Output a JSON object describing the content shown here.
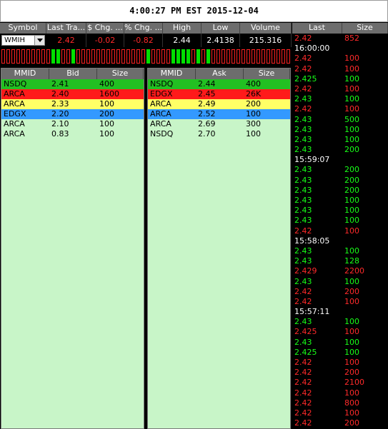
{
  "title": "4:00:27 PM EST 2015-12-04",
  "quote": {
    "headers": [
      "Symbol",
      "Last Tra...",
      "$ Chg. ...",
      "% Chg. ...",
      "High",
      "Low",
      "Volume"
    ],
    "symbol": "WMIH",
    "last": "2.42",
    "chg": "-0.02",
    "pct_chg": "-0.82",
    "high": "2.44",
    "low": "2.4138",
    "volume": "215.316"
  },
  "tick_pattern": [
    0,
    0,
    0,
    0,
    0,
    0,
    0,
    0,
    0,
    0,
    1,
    1,
    0,
    0,
    1,
    0,
    0,
    0,
    0,
    0,
    0,
    0,
    0,
    0,
    0,
    0,
    0,
    0,
    0,
    1,
    0,
    0,
    0,
    0,
    1,
    1,
    1,
    1,
    0,
    1,
    0,
    1,
    0,
    0,
    0,
    0,
    0,
    0,
    0,
    0,
    0,
    0,
    0,
    0,
    0,
    0,
    0,
    0
  ],
  "bid_panel": {
    "headers": [
      "MMID",
      "Bid",
      "Size"
    ],
    "rows": [
      {
        "mmid": "NSDQ",
        "price": "2.41",
        "size": "400",
        "color": "#22c022"
      },
      {
        "mmid": "ARCA",
        "price": "2.40",
        "size": "1600",
        "color": "#ff1a1a"
      },
      {
        "mmid": "ARCA",
        "price": "2.33",
        "size": "100",
        "color": "#ffff66"
      },
      {
        "mmid": "EDGX",
        "price": "2.20",
        "size": "200",
        "color": "#3399ff"
      },
      {
        "mmid": "ARCA",
        "price": "2.10",
        "size": "100",
        "color": "#c8f5c8"
      },
      {
        "mmid": "ARCA",
        "price": "0.83",
        "size": "100",
        "color": "#c8f5c8"
      }
    ]
  },
  "ask_panel": {
    "headers": [
      "MMID",
      "Ask",
      "Size"
    ],
    "rows": [
      {
        "mmid": "NSDQ",
        "price": "2.44",
        "size": "400",
        "color": "#22c022"
      },
      {
        "mmid": "EDGX",
        "price": "2.45",
        "size": "26K",
        "color": "#ff1a1a"
      },
      {
        "mmid": "ARCA",
        "price": "2.49",
        "size": "200",
        "color": "#ffff66"
      },
      {
        "mmid": "ARCA",
        "price": "2.52",
        "size": "100",
        "color": "#3399ff"
      },
      {
        "mmid": "ARCA",
        "price": "2.69",
        "size": "300",
        "color": "#c8f5c8"
      },
      {
        "mmid": "NSDQ",
        "price": "2.70",
        "size": "100",
        "color": "#c8f5c8"
      }
    ]
  },
  "time_sales": {
    "headers": [
      "Last",
      "Size"
    ],
    "rows": [
      {
        "p": "2.42",
        "s": "852",
        "c": "red"
      },
      {
        "time": "16:00:00"
      },
      {
        "p": "2.42",
        "s": "100",
        "c": "red"
      },
      {
        "p": "2.42",
        "s": "100",
        "c": "red"
      },
      {
        "p": "2.425",
        "s": "100",
        "c": "green"
      },
      {
        "p": "2.42",
        "s": "100",
        "c": "red"
      },
      {
        "p": "2.43",
        "s": "100",
        "c": "green"
      },
      {
        "p": "2.42",
        "s": "100",
        "c": "red"
      },
      {
        "p": "2.43",
        "s": "500",
        "c": "green"
      },
      {
        "p": "2.43",
        "s": "100",
        "c": "green"
      },
      {
        "p": "2.43",
        "s": "100",
        "c": "green"
      },
      {
        "p": "2.43",
        "s": "200",
        "c": "green"
      },
      {
        "time": "15:59:07"
      },
      {
        "p": "2.43",
        "s": "200",
        "c": "green"
      },
      {
        "p": "2.43",
        "s": "200",
        "c": "green"
      },
      {
        "p": "2.43",
        "s": "200",
        "c": "green"
      },
      {
        "p": "2.43",
        "s": "100",
        "c": "green"
      },
      {
        "p": "2.43",
        "s": "100",
        "c": "green"
      },
      {
        "p": "2.43",
        "s": "100",
        "c": "green"
      },
      {
        "p": "2.42",
        "s": "100",
        "c": "red"
      },
      {
        "time": "15:58:05"
      },
      {
        "p": "2.43",
        "s": "100",
        "c": "green"
      },
      {
        "p": "2.43",
        "s": "128",
        "c": "green"
      },
      {
        "p": "2.429",
        "s": "2200",
        "c": "red"
      },
      {
        "p": "2.43",
        "s": "100",
        "c": "green"
      },
      {
        "p": "2.42",
        "s": "200",
        "c": "red"
      },
      {
        "p": "2.42",
        "s": "100",
        "c": "red"
      },
      {
        "time": "15:57:11"
      },
      {
        "p": "2.43",
        "s": "100",
        "c": "green"
      },
      {
        "p": "2.425",
        "s": "100",
        "c": "red"
      },
      {
        "p": "2.43",
        "s": "100",
        "c": "green"
      },
      {
        "p": "2.425",
        "s": "100",
        "c": "green"
      },
      {
        "p": "2.42",
        "s": "100",
        "c": "red"
      },
      {
        "p": "2.42",
        "s": "200",
        "c": "red"
      },
      {
        "p": "2.42",
        "s": "2100",
        "c": "red"
      },
      {
        "p": "2.42",
        "s": "100",
        "c": "red"
      },
      {
        "p": "2.42",
        "s": "800",
        "c": "red"
      },
      {
        "p": "2.42",
        "s": "100",
        "c": "red"
      },
      {
        "p": "2.42",
        "s": "200",
        "c": "red"
      }
    ]
  }
}
